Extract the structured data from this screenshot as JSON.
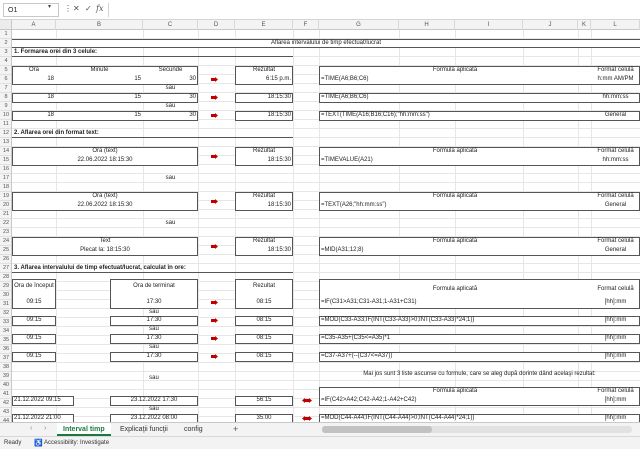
{
  "formula_bar": {
    "name_box": "O1",
    "fx": "fx",
    "cancel_icon": "✕",
    "enter_icon": "✓",
    "value": ""
  },
  "columns": [
    "A",
    "B",
    "C",
    "D",
    "E",
    "F",
    "G",
    "H",
    "I",
    "J",
    "K",
    "L"
  ],
  "rows": [
    "1",
    "2",
    "3",
    "4",
    "5",
    "6",
    "7",
    "8",
    "9",
    "10",
    "11",
    "12",
    "13",
    "14",
    "15",
    "16",
    "17",
    "18",
    "19",
    "20",
    "21",
    "22",
    "23",
    "24",
    "25",
    "26",
    "27",
    "28",
    "29",
    "30",
    "31",
    "32",
    "33",
    "34",
    "35",
    "36",
    "37",
    "38",
    "39",
    "40",
    "41",
    "42",
    "43",
    "44"
  ],
  "sheet": {
    "title": "Aflarea intervalului de timp efectuat/lucrat",
    "sec1": "1. Formarea orei din 3 celule:",
    "sec2": "2. Aflarea orei din format text:",
    "sec3": "3. Aflarea intervalului de timp efectuat/lucrat, calculat în ore:",
    "ora": "Ora",
    "minute": "Minute",
    "secunde": "Secunde",
    "rezultat": "Rezultat",
    "formula_aplicata": "Formula aplicată",
    "format_celula": "Format celulă",
    "sau": "sau",
    "r6": {
      "a": "18",
      "b": "15",
      "c": "30",
      "res": "6:15 p.m.",
      "formula": "=TIME(A6;B6;C6)",
      "fmt": "h:mm AM/PM"
    },
    "r8": {
      "a": "18",
      "b": "15",
      "c": "30",
      "res": "18:15:30",
      "formula": "=TIME(A6;B6;C6)",
      "fmt": "hh:mm:ss"
    },
    "r10": {
      "a": "18",
      "b": "15",
      "c": "30",
      "res": "18:15:30",
      "formula": "=TEXT(TIME(A16;B16;C16);\"hh:mm:ss\")",
      "fmt": "General"
    },
    "ora_text": "Ora (text)",
    "r15": {
      "val": "22.06.2022  18:15:30",
      "res": "18:15:30",
      "formula": "=TIMEVALUE(A21)",
      "fmt": "hh:mm:ss"
    },
    "r20": {
      "val": "22.06.2022  18:15:30",
      "res": "18:15:30",
      "formula": "=TEXT(A26;\"hh:mm:ss\")",
      "fmt": "General"
    },
    "text_label": "Text",
    "r25": {
      "val": "Plecat la: 18:15:30",
      "res": "18:15:30",
      "formula": "=MID(A31;12;8)",
      "fmt": "General"
    },
    "ora_inceput": "Ora de început",
    "ora_terminat": "Ora de terminat",
    "r31": {
      "start": "09:15",
      "end": "17:30",
      "res": "08:15",
      "formula": "=IF(C31>A31;C31-A31;1-A31+C31)",
      "fmt": "[hh]:mm"
    },
    "r33": {
      "start": "09:15",
      "end": "17:30",
      "res": "08:15",
      "formula": "=MOD(C33-A33;IF(INT(C33-A33)>0;INT(C33-A33)*24;1))",
      "fmt": "[hh]:mm"
    },
    "r35": {
      "start": "09:15",
      "end": "17:30",
      "res": "08:15",
      "formula": "=C35-A35+(C35<=A35)*1",
      "fmt": "[hh]:mm"
    },
    "r37": {
      "start": "09:15",
      "end": "17:30",
      "res": "08:15",
      "formula": "=C37-A37+(--(C37<=A37))",
      "fmt": "[hh]:mm"
    },
    "note40": "Mai jos sunt 3 liste ascunse cu formule, care se aleg după dorinte dând acelaşi rezultat:",
    "r42": {
      "start": "21.12.2022 09:15",
      "end": "23.12.2022 17:30",
      "res": "56:15",
      "formula": "=IF(C42>A42;C42-A42;1-A42+C42)",
      "fmt": "[hh]:mm"
    },
    "r44": {
      "start": "21.12.2022 21:00",
      "end": "23.12.2022 08:00",
      "res": "35:00",
      "formula": "=MOD(C44-A44;IF(INT(C44-A44)>0;INT(C44-A44)*24;1))",
      "fmt": "[hh]:mm"
    }
  },
  "tabs": [
    "Interval timp",
    "Explicaţii funcţii",
    "config"
  ],
  "status": {
    "ready": "Ready",
    "accessibility": "Accessibility: Investigate"
  },
  "colors": {
    "accent": "#1a7a3c",
    "arrow": "#c00000"
  }
}
